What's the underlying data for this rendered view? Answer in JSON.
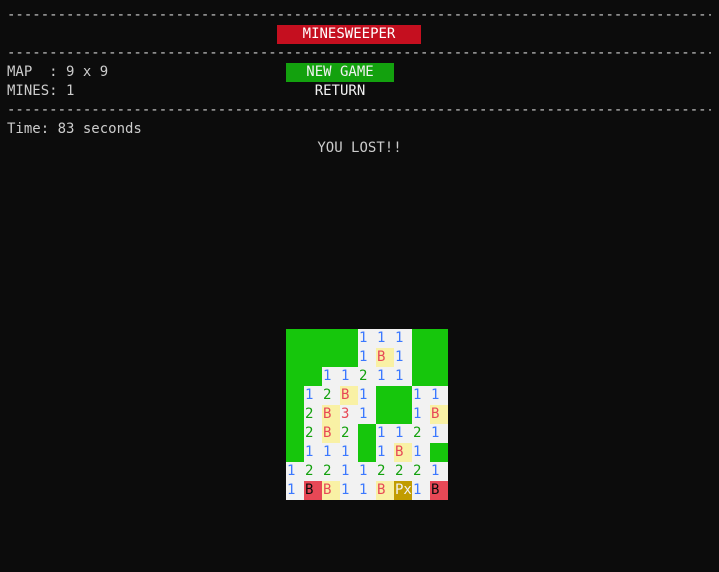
{
  "rule_line": "--------------------------------------------------------------------------------------------",
  "title": "MINESWEEPER",
  "info": {
    "map": "MAP  : 9 x 9",
    "mines": "MINES: 1",
    "time": "Time: 83 seconds"
  },
  "menu": {
    "new_game": "NEW GAME",
    "return": "RETURN"
  },
  "status": "YOU LOST!!",
  "board": {
    "rows": [
      [
        {
          "t": "",
          "k": "hidden"
        },
        {
          "t": "",
          "k": "hidden"
        },
        {
          "t": "",
          "k": "hidden"
        },
        {
          "t": "",
          "k": "hidden"
        },
        {
          "t": "1",
          "k": "open n1"
        },
        {
          "t": "1",
          "k": "open n1"
        },
        {
          "t": "1",
          "k": "open n1"
        },
        {
          "t": "",
          "k": "hidden"
        },
        {
          "t": "",
          "k": "hidden"
        }
      ],
      [
        {
          "t": "",
          "k": "hidden"
        },
        {
          "t": "",
          "k": "hidden"
        },
        {
          "t": "",
          "k": "hidden"
        },
        {
          "t": "",
          "k": "hidden"
        },
        {
          "t": "1",
          "k": "open n1"
        },
        {
          "t": "B",
          "k": "bomb"
        },
        {
          "t": "1",
          "k": "open n1"
        },
        {
          "t": "",
          "k": "hidden"
        },
        {
          "t": "",
          "k": "hidden"
        }
      ],
      [
        {
          "t": "",
          "k": "hidden"
        },
        {
          "t": "",
          "k": "hidden"
        },
        {
          "t": "1",
          "k": "open n1"
        },
        {
          "t": "1",
          "k": "open n1"
        },
        {
          "t": "2",
          "k": "open n2"
        },
        {
          "t": "1",
          "k": "open n1"
        },
        {
          "t": "1",
          "k": "open n1"
        },
        {
          "t": "",
          "k": "hidden"
        },
        {
          "t": "",
          "k": "hidden"
        }
      ],
      [
        {
          "t": "",
          "k": "hidden"
        },
        {
          "t": "1",
          "k": "open n1"
        },
        {
          "t": "2",
          "k": "open n2"
        },
        {
          "t": "B",
          "k": "bomb"
        },
        {
          "t": "1",
          "k": "open n1"
        },
        {
          "t": "",
          "k": "hidden"
        },
        {
          "t": "",
          "k": "hidden"
        },
        {
          "t": "1",
          "k": "open n1"
        },
        {
          "t": "1",
          "k": "open n1"
        }
      ],
      [
        {
          "t": "",
          "k": "hidden"
        },
        {
          "t": "2",
          "k": "open n2"
        },
        {
          "t": "B",
          "k": "bomb"
        },
        {
          "t": "3",
          "k": "open n3"
        },
        {
          "t": "1",
          "k": "open n1"
        },
        {
          "t": "",
          "k": "hidden"
        },
        {
          "t": "",
          "k": "hidden"
        },
        {
          "t": "1",
          "k": "open n1"
        },
        {
          "t": "B",
          "k": "bomb"
        }
      ],
      [
        {
          "t": "",
          "k": "hidden"
        },
        {
          "t": "2",
          "k": "open n2"
        },
        {
          "t": "B",
          "k": "bomb"
        },
        {
          "t": "2",
          "k": "open n2"
        },
        {
          "t": "",
          "k": "hidden"
        },
        {
          "t": "1",
          "k": "open n1"
        },
        {
          "t": "1",
          "k": "open n1"
        },
        {
          "t": "2",
          "k": "open n2"
        },
        {
          "t": "1",
          "k": "open n1"
        }
      ],
      [
        {
          "t": "",
          "k": "hidden"
        },
        {
          "t": "1",
          "k": "open n1"
        },
        {
          "t": "1",
          "k": "open n1"
        },
        {
          "t": "1",
          "k": "open n1"
        },
        {
          "t": "",
          "k": "hidden"
        },
        {
          "t": "1",
          "k": "open n1"
        },
        {
          "t": "B",
          "k": "bomb"
        },
        {
          "t": "1",
          "k": "open n1"
        },
        {
          "t": "",
          "k": "hidden"
        }
      ],
      [
        {
          "t": "1",
          "k": "open n1"
        },
        {
          "t": "2",
          "k": "open n2"
        },
        {
          "t": "2",
          "k": "open n2"
        },
        {
          "t": "1",
          "k": "open n1"
        },
        {
          "t": "1",
          "k": "open n1"
        },
        {
          "t": "2",
          "k": "open n2"
        },
        {
          "t": "2",
          "k": "open n2"
        },
        {
          "t": "2",
          "k": "open n2"
        },
        {
          "t": "1",
          "k": "open n1"
        }
      ],
      [
        {
          "t": "1",
          "k": "open n1"
        },
        {
          "t": "B",
          "k": "bomb-hit"
        },
        {
          "t": "B",
          "k": "bomb"
        },
        {
          "t": "1",
          "k": "open n1"
        },
        {
          "t": "1",
          "k": "open n1"
        },
        {
          "t": "B",
          "k": "bomb"
        },
        {
          "t": "Px",
          "k": "player"
        },
        {
          "t": "1",
          "k": "open n1"
        },
        {
          "t": "B",
          "k": "bomb-hit"
        }
      ]
    ]
  },
  "colors": {
    "background": "#0c0c0c",
    "title_bg": "#c50f1f",
    "button_bg": "#13a10e",
    "hidden_cell": "#16c60c",
    "open_cell": "#f2f2f2",
    "bomb_hit": "#e74856",
    "player": "#c19c00"
  }
}
